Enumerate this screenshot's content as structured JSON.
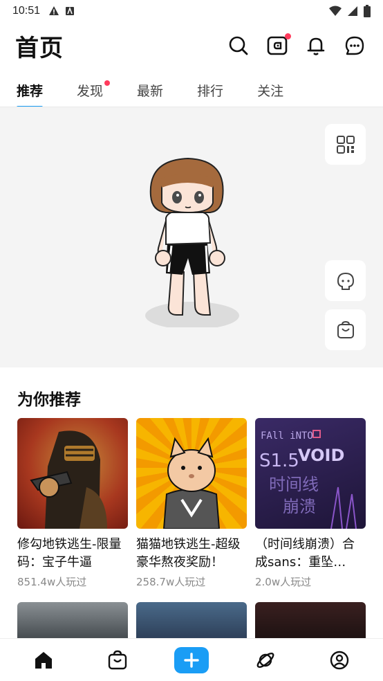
{
  "status_bar": {
    "time": "10:51"
  },
  "header": {
    "title": "首页",
    "icons": [
      "search-icon",
      "wallet-icon",
      "bell-icon",
      "message-icon"
    ]
  },
  "tabs": [
    {
      "label": "推荐",
      "active": true
    },
    {
      "label": "发现",
      "badge": true
    },
    {
      "label": "最新"
    },
    {
      "label": "排行"
    },
    {
      "label": "关注"
    }
  ],
  "hero": {
    "side_buttons": [
      "qr-code-icon",
      "avatar-face-icon",
      "shop-bag-icon"
    ]
  },
  "recommend": {
    "title": "为你推荐",
    "cards": [
      {
        "title": "修勾地铁逃生-限量码：宝子牛逼",
        "plays": "851.4w人玩过"
      },
      {
        "title": "猫猫地铁逃生-超级豪华熬夜奖励！",
        "plays": "258.7w人玩过"
      },
      {
        "title": "（时间线崩溃）合成sans：重坠…",
        "plays": "2.0w人玩过"
      }
    ]
  },
  "thumb_text": {
    "void_title": "FAll iNTO",
    "void_logo": "VOID",
    "void_ver": "S1.5",
    "void_sub1": "时间线",
    "void_sub2": "崩溃"
  },
  "bottom_nav": [
    "home-icon",
    "bag-icon",
    "plus-icon",
    "planet-icon",
    "profile-icon"
  ],
  "colors": {
    "accent": "#1a9df5",
    "badge": "#ff3b5c"
  }
}
